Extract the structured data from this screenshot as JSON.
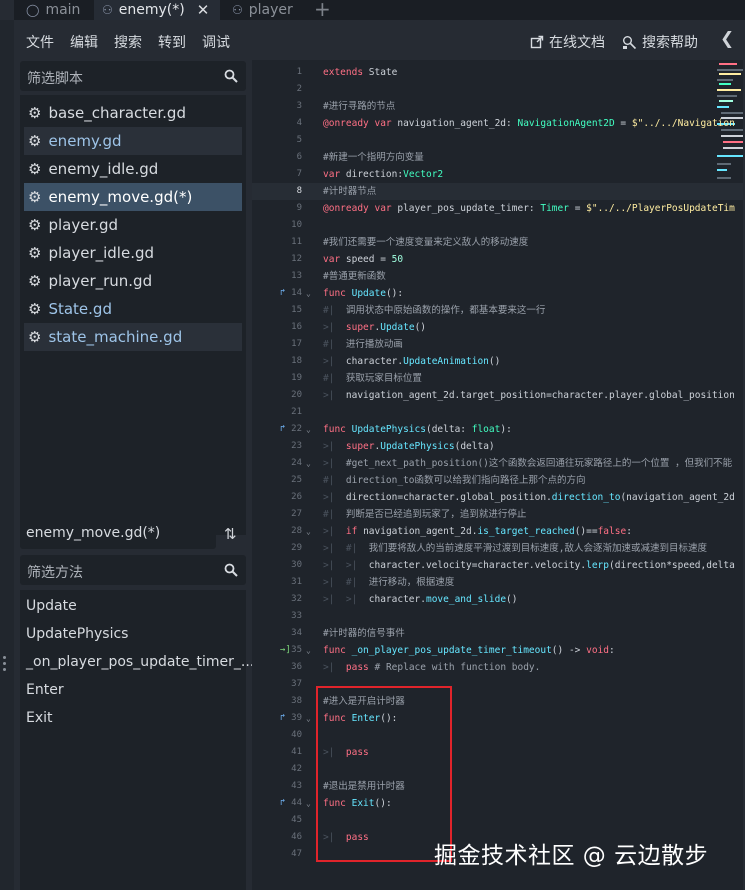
{
  "tabs": {
    "main": "main",
    "active": "enemy(*)",
    "player": "player",
    "close": "✕",
    "add": "+"
  },
  "menu": {
    "file": "文件",
    "edit": "编辑",
    "search": "搜索",
    "goto": "转到",
    "debug": "调试",
    "online_docs": "在线文档",
    "search_help": "搜索帮助"
  },
  "sidebar": {
    "filter_scripts_placeholder": "筛选脚本",
    "scripts": [
      {
        "name": "base_character.gd",
        "style": "normal"
      },
      {
        "name": "enemy.gd",
        "style": "tool-hl"
      },
      {
        "name": "enemy_idle.gd",
        "style": "normal"
      },
      {
        "name": "enemy_move.gd(*)",
        "style": "selected"
      },
      {
        "name": "player.gd",
        "style": "normal"
      },
      {
        "name": "player_idle.gd",
        "style": "normal"
      },
      {
        "name": "player_run.gd",
        "style": "normal"
      },
      {
        "name": "State.gd",
        "style": "tool"
      },
      {
        "name": "state_machine.gd",
        "style": "tool-hl"
      }
    ],
    "current_file": "enemy_move.gd(*)",
    "filter_methods_placeholder": "筛选方法",
    "methods": [
      "Update",
      "UpdatePhysics",
      "_on_player_pos_update_timer_...",
      "Enter",
      "Exit"
    ]
  },
  "code_lines": [
    {
      "n": "1",
      "t": [
        [
          "kw",
          "extends "
        ],
        [
          "plain",
          "State"
        ]
      ]
    },
    {
      "n": "2",
      "t": []
    },
    {
      "n": "3",
      "t": [
        [
          "cm",
          "#进行寻路的节点"
        ]
      ]
    },
    {
      "n": "4",
      "t": [
        [
          "kw",
          "@onready var "
        ],
        [
          "plain",
          "navigation_agent_2d: "
        ],
        [
          "ty",
          "NavigationAgent2D"
        ],
        [
          "plain",
          " = "
        ],
        [
          "str",
          "$\"../../Navigation"
        ]
      ]
    },
    {
      "n": "5",
      "t": []
    },
    {
      "n": "6",
      "t": [
        [
          "cm",
          "#新建一个指明方向变量"
        ]
      ]
    },
    {
      "n": "7",
      "t": [
        [
          "kw",
          "var "
        ],
        [
          "plain",
          "direction:"
        ],
        [
          "ty",
          "Vector2"
        ]
      ]
    },
    {
      "n": "8",
      "t": [
        [
          "cm",
          "#计时器节点"
        ]
      ],
      "cur": true
    },
    {
      "n": "9",
      "t": [
        [
          "kw",
          "@onready var "
        ],
        [
          "plain",
          "player_pos_update_timer: "
        ],
        [
          "ty",
          "Timer"
        ],
        [
          "plain",
          " = "
        ],
        [
          "str",
          "$\"../../PlayerPosUpdateTim"
        ]
      ]
    },
    {
      "n": "10",
      "t": []
    },
    {
      "n": "11",
      "t": [
        [
          "cm",
          "#我们还需要一个速度变量来定义敌人的移动速度"
        ]
      ]
    },
    {
      "n": "12",
      "t": [
        [
          "kw",
          "var "
        ],
        [
          "plain",
          "speed = "
        ],
        [
          "num",
          "50"
        ]
      ]
    },
    {
      "n": "13",
      "t": [
        [
          "cm",
          "#普通更新函数"
        ]
      ]
    },
    {
      "n": "14",
      "t": [
        [
          "kw",
          "func "
        ],
        [
          "fn",
          "Update"
        ],
        [
          "plain",
          "():"
        ]
      ],
      "gut": "ov",
      "fold": true
    },
    {
      "n": "15",
      "t": [
        [
          "ind",
          "#|  "
        ],
        [
          "cm",
          "调用状态中原始函数的操作，都基本要来这一行"
        ]
      ]
    },
    {
      "n": "16",
      "t": [
        [
          "ind",
          ">|  "
        ],
        [
          "kw",
          "super"
        ],
        [
          "plain",
          "."
        ],
        [
          "fn",
          "Update"
        ],
        [
          "plain",
          "()"
        ]
      ]
    },
    {
      "n": "17",
      "t": [
        [
          "ind",
          "#|  "
        ],
        [
          "cm",
          "进行播放动画"
        ]
      ]
    },
    {
      "n": "18",
      "t": [
        [
          "ind",
          ">|  "
        ],
        [
          "plain",
          "character."
        ],
        [
          "fn",
          "UpdateAnimation"
        ],
        [
          "plain",
          "()"
        ]
      ]
    },
    {
      "n": "19",
      "t": [
        [
          "ind",
          "#|  "
        ],
        [
          "cm",
          "获取玩家目标位置"
        ]
      ]
    },
    {
      "n": "20",
      "t": [
        [
          "ind",
          ">|  "
        ],
        [
          "plain",
          "navigation_agent_2d.target_position=character.player.global_position"
        ]
      ]
    },
    {
      "n": "21",
      "t": []
    },
    {
      "n": "22",
      "t": [
        [
          "kw",
          "func "
        ],
        [
          "fn",
          "UpdatePhysics"
        ],
        [
          "plain",
          "(delta: "
        ],
        [
          "ty",
          "float"
        ],
        [
          "plain",
          "):"
        ]
      ],
      "gut": "ov",
      "fold": true
    },
    {
      "n": "23",
      "t": [
        [
          "ind",
          ">|  "
        ],
        [
          "kw",
          "super"
        ],
        [
          "plain",
          "."
        ],
        [
          "fn",
          "UpdatePhysics"
        ],
        [
          "plain",
          "(delta)"
        ]
      ]
    },
    {
      "n": "24",
      "t": [
        [
          "ind",
          ">|  "
        ],
        [
          "cm",
          "#get_next_path_position()这个函数会返回通往玩家路径上的一个位置 ，但我们不能"
        ]
      ],
      "fold": true
    },
    {
      "n": "25",
      "t": [
        [
          "ind",
          "#|  "
        ],
        [
          "cm",
          "direction_to函数可以给我们指向路径上那个点的方向"
        ]
      ]
    },
    {
      "n": "26",
      "t": [
        [
          "ind",
          ">|  "
        ],
        [
          "plain",
          "direction=character.global_position."
        ],
        [
          "fn",
          "direction_to"
        ],
        [
          "plain",
          "(navigation_agent_2d"
        ]
      ]
    },
    {
      "n": "27",
      "t": [
        [
          "ind",
          "#|  "
        ],
        [
          "cm",
          "判断是否已经追到玩家了，追到就进行停止"
        ]
      ]
    },
    {
      "n": "28",
      "t": [
        [
          "ind",
          ">|  "
        ],
        [
          "kw",
          "if "
        ],
        [
          "plain",
          "navigation_agent_2d."
        ],
        [
          "fn",
          "is_target_reached"
        ],
        [
          "plain",
          "()=="
        ],
        [
          "kw",
          "false"
        ],
        [
          "plain",
          ":"
        ]
      ],
      "fold": true
    },
    {
      "n": "29",
      "t": [
        [
          "ind",
          ">|  #|  "
        ],
        [
          "cm",
          "我们要将敌人的当前速度平滑过渡到目标速度,敌人会逐渐加速或减速到目标速度"
        ]
      ]
    },
    {
      "n": "30",
      "t": [
        [
          "ind",
          ">|  >|  "
        ],
        [
          "plain",
          "character.velocity=character.velocity."
        ],
        [
          "fn",
          "lerp"
        ],
        [
          "plain",
          "(direction*speed,delta"
        ]
      ]
    },
    {
      "n": "31",
      "t": [
        [
          "ind",
          ">|  #|  "
        ],
        [
          "cm",
          "进行移动，根据速度"
        ]
      ]
    },
    {
      "n": "32",
      "t": [
        [
          "ind",
          ">|  >|  "
        ],
        [
          "plain",
          "character."
        ],
        [
          "fn",
          "move_and_slide"
        ],
        [
          "plain",
          "()"
        ]
      ]
    },
    {
      "n": "33",
      "t": []
    },
    {
      "n": "34",
      "t": [
        [
          "cm",
          "#计时器的信号事件"
        ]
      ]
    },
    {
      "n": "35",
      "t": [
        [
          "kw",
          "func "
        ],
        [
          "fn",
          "_on_player_pos_update_timer_timeout"
        ],
        [
          "plain",
          "() -> "
        ],
        [
          "kw",
          "void"
        ],
        [
          "plain",
          ":"
        ]
      ],
      "gut": "sig",
      "fold": true
    },
    {
      "n": "36",
      "t": [
        [
          "ind",
          ">|  "
        ],
        [
          "kw",
          "pass "
        ],
        [
          "cm",
          "# Replace with function body."
        ]
      ]
    },
    {
      "n": "37",
      "t": []
    },
    {
      "n": "38",
      "t": [
        [
          "cm",
          "#进入是开启计时器"
        ]
      ]
    },
    {
      "n": "39",
      "t": [
        [
          "kw",
          "func "
        ],
        [
          "fn",
          "Enter"
        ],
        [
          "plain",
          "():"
        ]
      ],
      "gut": "ov",
      "fold": true
    },
    {
      "n": "40",
      "t": []
    },
    {
      "n": "41",
      "t": [
        [
          "ind",
          ">|  "
        ],
        [
          "kw",
          "pass"
        ]
      ]
    },
    {
      "n": "42",
      "t": []
    },
    {
      "n": "43",
      "t": [
        [
          "cm",
          "#退出是禁用计时器"
        ]
      ]
    },
    {
      "n": "44",
      "t": [
        [
          "kw",
          "func "
        ],
        [
          "fn",
          "Exit"
        ],
        [
          "plain",
          "():"
        ]
      ],
      "gut": "ov",
      "fold": true
    },
    {
      "n": "45",
      "t": []
    },
    {
      "n": "46",
      "t": [
        [
          "ind",
          ">|  "
        ],
        [
          "kw",
          "pass"
        ]
      ]
    },
    {
      "n": "47",
      "t": []
    }
  ],
  "watermark": "掘金技术社区 @ 云边散步",
  "colors": {
    "keyword": "#ff7085",
    "function": "#66e6ff",
    "type": "#42ffc2",
    "comment": "#9aa1ab",
    "string": "#ffeda1",
    "selection": "#3c5166",
    "highlight_box": "#e0242b"
  }
}
